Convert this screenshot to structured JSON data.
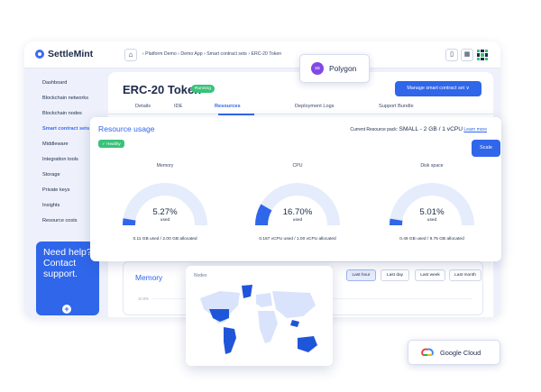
{
  "app": {
    "logo_text": "SettleMint"
  },
  "breadcrumb": {
    "home_icon": "home-icon",
    "text": "‹ Platform Demo › Demo App › Smart contract sets › ERC-20 Token"
  },
  "sidebar": {
    "items": [
      {
        "label": "Dashboard"
      },
      {
        "label": "Blockchain networks"
      },
      {
        "label": "Blockchain nodes"
      },
      {
        "label": "Smart contract sets"
      },
      {
        "label": "Middleware"
      },
      {
        "label": "Integration tools"
      },
      {
        "label": "Storage"
      },
      {
        "label": "Private keys"
      },
      {
        "label": "Insights"
      },
      {
        "label": "Resource costs"
      }
    ]
  },
  "help": {
    "text": "Need help? Contact support."
  },
  "page": {
    "title": "ERC-20 Token",
    "status": "Running",
    "manage_button": "Manage smart contract set ∨",
    "tabs": [
      {
        "label": "Details"
      },
      {
        "label": "IDE"
      },
      {
        "label": "Resources"
      },
      {
        "label": "Deployment Logs"
      },
      {
        "label": "Support Bundle"
      }
    ]
  },
  "polygon": {
    "label": "Polygon"
  },
  "resource_usage": {
    "title": "Resource usage",
    "health": "Healthy",
    "pack_label": "Current Resource pack:",
    "pack_value": "SMALL - 2 GB / 1 vCPU",
    "learn_more": "Learn more",
    "scale_button": "Scale",
    "gauges": [
      {
        "label": "Memory",
        "value": "5.27%",
        "pct": 5.27,
        "unit": "used",
        "detail": "0.11 GB used / 2.00 GB allocated"
      },
      {
        "label": "CPU",
        "value": "16.70%",
        "pct": 16.7,
        "unit": "used",
        "detail": "0.167 vCPU used / 1.00 vCPU allocated"
      },
      {
        "label": "Disk space",
        "value": "5.01%",
        "pct": 5.01,
        "unit": "used",
        "detail": "0.49 GB used / 9.75 GB allocated"
      }
    ]
  },
  "memory_chart": {
    "title": "Memory",
    "tick": "10.0%",
    "ranges": [
      {
        "label": "Last hour"
      },
      {
        "label": "Last day"
      },
      {
        "label": "Last week"
      },
      {
        "label": "Last month"
      }
    ]
  },
  "nodes": {
    "title": "Nodes"
  },
  "google_cloud": {
    "label": "Google Cloud"
  },
  "colors": {
    "accent": "#2f66ea",
    "healthy": "#39c27a",
    "polygon": "#8247e5"
  }
}
